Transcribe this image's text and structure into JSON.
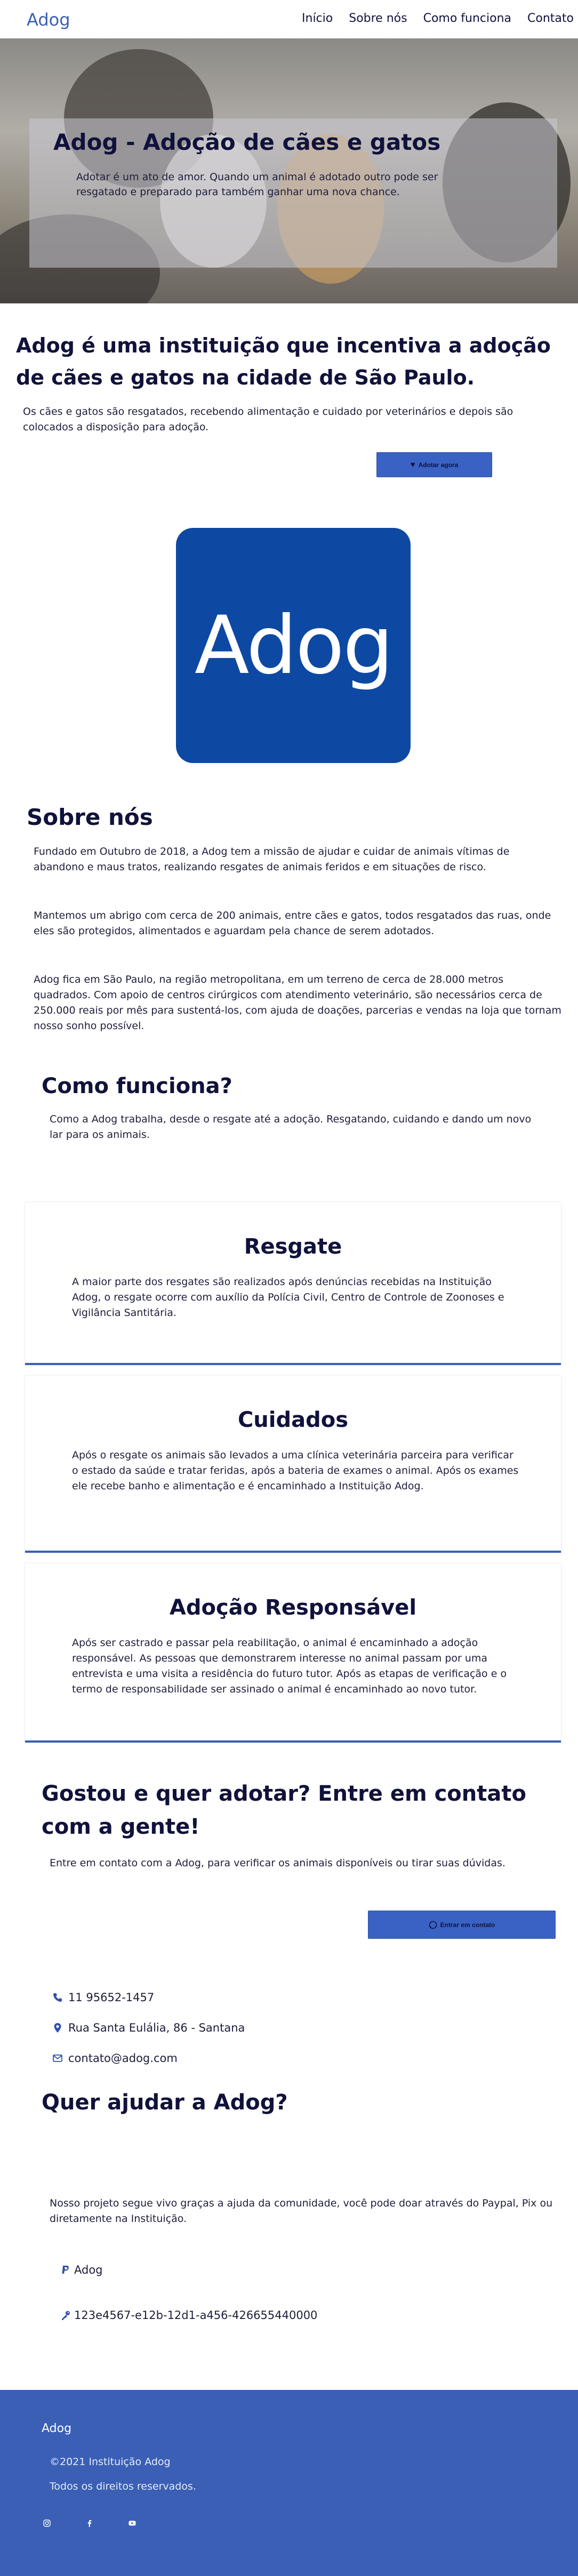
{
  "nav": {
    "brand": "Adog",
    "links": [
      "Início",
      "Sobre nós",
      "Como funciona",
      "Contato"
    ]
  },
  "hero": {
    "title": "Adog - Adoção de cães e gatos",
    "text": "Adotar é um ato de amor. Quando um animal é adotado outro pode ser resgatado e preparado para também ganhar uma nova chance."
  },
  "intro": {
    "title": "Adog é uma instituição que incentiva a adoção de cães e gatos na cidade de São Paulo.",
    "text": "Os cães e gatos são resgatados, recebendo alimentação e cuidado por veterinários e depois são colocados a disposição para adoção.",
    "button": "Adotar agora"
  },
  "logo": {
    "text": "Adog"
  },
  "sobre": {
    "title": "Sobre nós",
    "paragraphs": [
      "Fundado em Outubro de 2018, a Adog tem a missão de ajudar e cuidar de animais vítimas de abandono e maus tratos, realizando resgates de animais feridos e em situações de risco.",
      "Mantemos um abrigo com cerca de 200 animais, entre cães e gatos, todos resgatados das ruas, onde eles são protegidos, alimentados e aguardam pela chance de serem adotados.",
      "Adog fica em São Paulo, na região metropolitana, em um terreno de cerca de 28.000 metros quadrados. Com apoio de centros cirúrgicos com atendimento veterinário, são necessários cerca de 250.000 reais por mês para sustentá-los, com ajuda de doações, parcerias e vendas na loja que tornam nosso sonho possível."
    ]
  },
  "como": {
    "title": "Como funciona?",
    "text": "Como a Adog trabalha, desde o resgate até a adoção. Resgatando, cuidando e dando um novo lar para os animais."
  },
  "cards": [
    {
      "title": "Resgate",
      "text": "A maior parte dos resgates são realizados após denúncias recebidas na Instituição Adog, o resgate ocorre com auxílio da Polícia Civil, Centro de Controle de Zoonoses e Vigilância Santitária."
    },
    {
      "title": "Cuidados",
      "text": "Após o resgate os animais são levados a uma clínica veterinária parceira para verificar o estado da saúde e tratar feridas, após a bateria de exames o animal. Após os exames ele recebe banho e alimentação e é encaminhado a Instituição Adog."
    },
    {
      "title": "Adoção Responsável",
      "text": "Após ser castrado e passar pela reabilitação, o animal é encaminhado a adoção responsável. As pessoas que demonstrarem interesse no animal passam por uma entrevista e uma visita a residência do futuro tutor. Após as etapas de verificação e o termo de responsabilidade ser assinado o animal é encaminhado ao novo tutor."
    }
  ],
  "contato": {
    "title": "Gostou e quer adotar? Entre em contato com a gente!",
    "text": "Entre em contato com a Adog, para verificar os animais disponíveis ou tirar suas dúvidas.",
    "button": "Entrar em contato",
    "phone": "11 95652-1457",
    "address": "Rua Santa Eulália, 86 - Santana",
    "email": "contato@adog.com"
  },
  "ajudar": {
    "title": "Quer ajudar a Adog?",
    "text": "Nosso projeto segue vivo graças a ajuda da comunidade, você pode doar através do Paypal, Pix ou diretamente na Instituição.",
    "paypal": "Adog",
    "pix": "123e4567-e12b-12d1-a456-426655440000"
  },
  "footer": {
    "brand": "Adog",
    "copy": "©2021 Instituição Adog",
    "rights": "Todos os direitos reservados."
  },
  "colors": {
    "primary": "#3a5fb5",
    "button": "#3a62c4",
    "logo_bg": "#0d49a3",
    "heading": "#10123b"
  },
  "icons": [
    "heart-icon",
    "whatsapp-icon",
    "phone-icon",
    "location-icon",
    "mail-icon",
    "paypal-icon",
    "key-icon",
    "instagram-icon",
    "facebook-icon",
    "youtube-icon"
  ]
}
